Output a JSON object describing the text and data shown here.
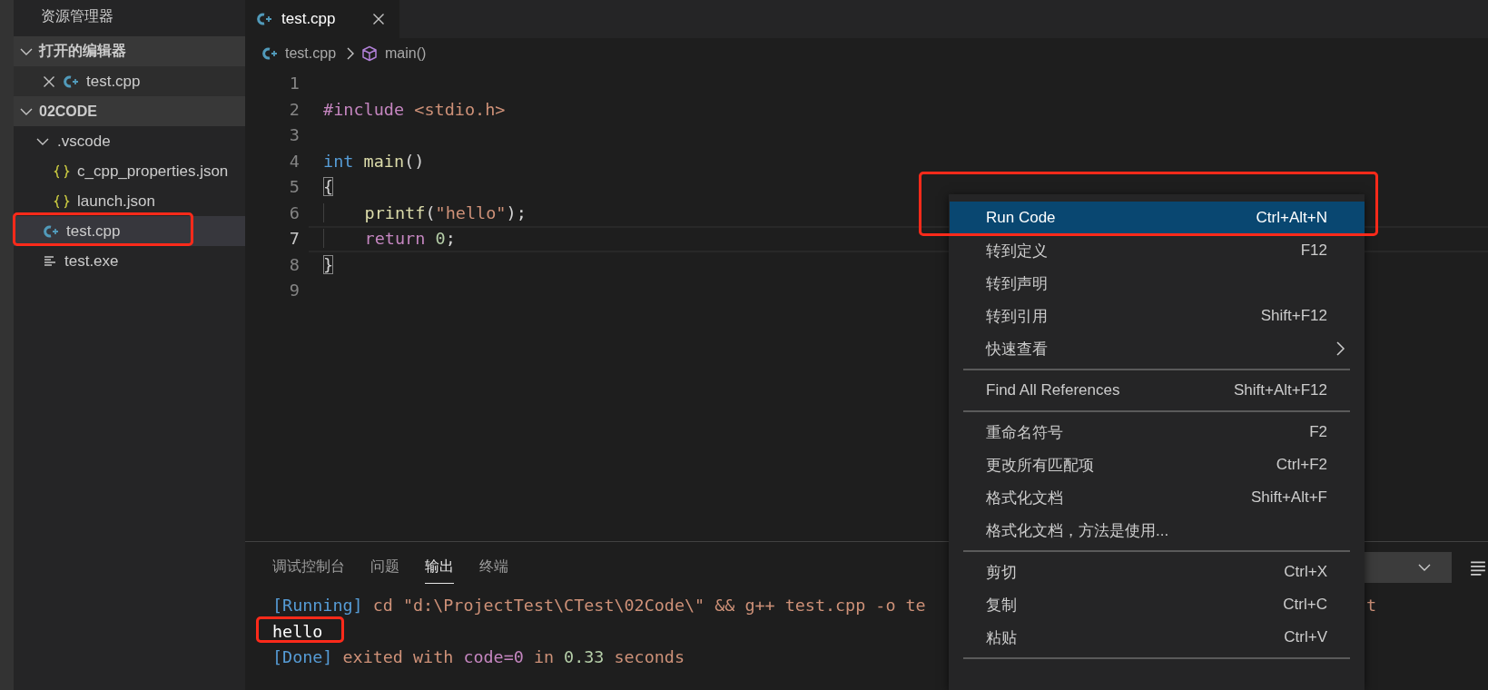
{
  "explorer": {
    "title": "资源管理器",
    "sections": [
      {
        "title": "打开的编辑器",
        "expanded": true,
        "items": [
          {
            "name": "test.cpp",
            "kind": "cpp",
            "closable": true,
            "selected": false,
            "highlighted": false
          }
        ]
      },
      {
        "title": "02CODE",
        "expanded": true,
        "items": [
          {
            "name": ".vscode",
            "kind": "folder",
            "expanded": true,
            "selected": false,
            "highlighted": false,
            "children": [
              {
                "name": "c_cpp_properties.json",
                "kind": "json",
                "selected": false,
                "highlighted": false
              },
              {
                "name": "launch.json",
                "kind": "json",
                "selected": false,
                "highlighted": false
              }
            ]
          },
          {
            "name": "test.cpp",
            "kind": "cpp",
            "selected": true,
            "highlighted": true
          },
          {
            "name": "test.exe",
            "kind": "text",
            "selected": false,
            "highlighted": false
          }
        ]
      }
    ]
  },
  "editor": {
    "tabs": [
      {
        "label": "test.cpp",
        "kind": "cpp",
        "selected": true
      }
    ],
    "breadcrumb": [
      {
        "label": "test.cpp",
        "kind": "cpp"
      },
      {
        "label": "main()",
        "kind": "function"
      }
    ],
    "lines": [
      {
        "number": "1",
        "current": false
      },
      {
        "number": "2",
        "current": false,
        "tokens": [
          {
            "kind": "directive",
            "text": "#include"
          },
          {
            "kind": "string",
            "text": " <stdio.h>"
          }
        ]
      },
      {
        "number": "3",
        "current": false
      },
      {
        "number": "4",
        "current": false,
        "tokens": [
          {
            "kind": "keyword",
            "text": "int"
          },
          {
            "kind": "function",
            "text": " main"
          },
          {
            "kind": "plain",
            "text": "()"
          }
        ]
      },
      {
        "number": "5",
        "current": false,
        "tokens": [
          {
            "kind": "bracket-match",
            "text": "{"
          }
        ]
      },
      {
        "number": "6",
        "current": false,
        "tokens": [
          {
            "kind": "function",
            "text": "    printf"
          },
          {
            "kind": "plain",
            "text": "("
          },
          {
            "kind": "string",
            "text": "\"hello\""
          },
          {
            "kind": "plain",
            "text": ");"
          }
        ]
      },
      {
        "number": "7",
        "current": true,
        "tokens": [
          {
            "kind": "control",
            "text": "    return"
          },
          {
            "kind": "number",
            "text": " 0"
          },
          {
            "kind": "plain",
            "text": ";"
          }
        ]
      },
      {
        "number": "8",
        "current": false,
        "tokens": [
          {
            "kind": "bracket-match",
            "text": "}"
          }
        ]
      },
      {
        "number": "9",
        "current": false
      }
    ]
  },
  "panel": {
    "tabs": [
      {
        "label": "调试控制台",
        "selected": false
      },
      {
        "label": "问题",
        "selected": false
      },
      {
        "label": "输出",
        "selected": true
      },
      {
        "label": "终端",
        "selected": false
      }
    ],
    "output": [
      {
        "highlighted": false,
        "tail": "t",
        "tokens": [
          {
            "kind": "tag",
            "text": "[Running]"
          },
          {
            "kind": "text",
            "text": " cd \"d:\\ProjectTest\\CTest\\02Code\\\" && g++ test.cpp -o te"
          }
        ]
      },
      {
        "highlighted": true,
        "tokens": [
          {
            "kind": "plain",
            "text": "hello"
          }
        ]
      },
      {
        "highlighted": false,
        "tokens": [
          {
            "kind": "tag",
            "text": "[Done]"
          },
          {
            "kind": "text",
            "text": " exited with "
          },
          {
            "kind": "keyword",
            "text": "code=0"
          },
          {
            "kind": "text",
            "text": " in "
          },
          {
            "kind": "number",
            "text": "0.33"
          },
          {
            "kind": "text",
            "text": " seconds"
          }
        ]
      }
    ]
  },
  "context_menu": {
    "groups": [
      {
        "items": [
          {
            "label": "Run Code",
            "shortcut": "Ctrl+Alt+N",
            "selected": true,
            "highlighted": true
          },
          {
            "label": "转到定义",
            "shortcut": "F12",
            "selected": false,
            "highlighted": false
          },
          {
            "label": "转到声明",
            "selected": false,
            "highlighted": false
          },
          {
            "label": "转到引用",
            "shortcut": "Shift+F12",
            "selected": false,
            "highlighted": false
          },
          {
            "label": "快速查看",
            "submenu": true,
            "selected": false,
            "highlighted": false
          }
        ]
      },
      {
        "items": [
          {
            "label": "Find All References",
            "shortcut": "Shift+Alt+F12",
            "selected": false,
            "highlighted": false
          }
        ]
      },
      {
        "items": [
          {
            "label": "重命名符号",
            "shortcut": "F2",
            "selected": false,
            "highlighted": false
          },
          {
            "label": "更改所有匹配项",
            "shortcut": "Ctrl+F2",
            "selected": false,
            "highlighted": false
          },
          {
            "label": "格式化文档",
            "shortcut": "Shift+Alt+F",
            "selected": false,
            "highlighted": false
          },
          {
            "label": "格式化文档，方法是使用...",
            "selected": false,
            "highlighted": false
          }
        ]
      },
      {
        "items": [
          {
            "label": "剪切",
            "shortcut": "Ctrl+X",
            "selected": false,
            "highlighted": false
          },
          {
            "label": "复制",
            "shortcut": "Ctrl+C",
            "selected": false,
            "highlighted": false
          },
          {
            "label": "粘贴",
            "shortcut": "Ctrl+V",
            "selected": false,
            "highlighted": false
          }
        ]
      }
    ]
  }
}
